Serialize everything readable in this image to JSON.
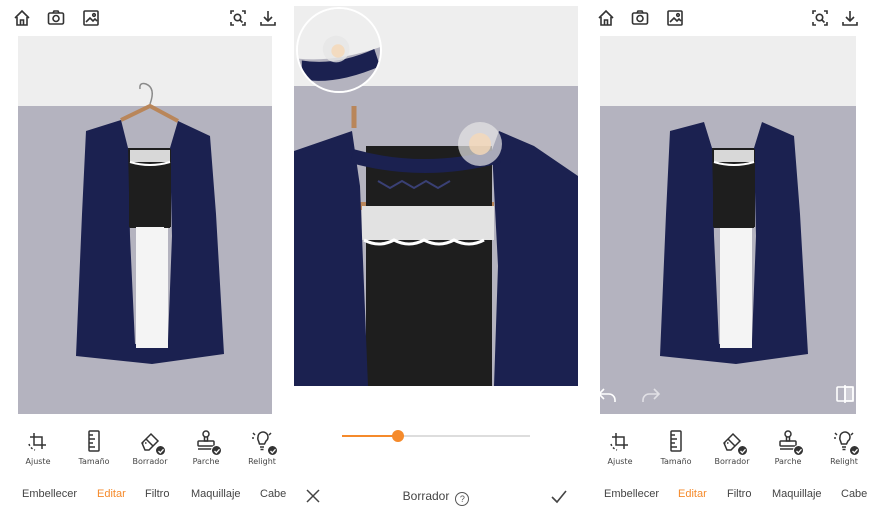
{
  "left_panel": {
    "tools": [
      {
        "label": "Ajuste",
        "icon": "crop-rotate-icon",
        "badge": false
      },
      {
        "label": "Tamaño",
        "icon": "ruler-icon",
        "badge": false
      },
      {
        "label": "Borrador",
        "icon": "eraser-icon",
        "badge": true
      },
      {
        "label": "Parche",
        "icon": "stamp-icon",
        "badge": true
      },
      {
        "label": "Relight",
        "icon": "lightbulb-icon",
        "badge": true
      }
    ],
    "nav": [
      "Embellecer",
      "Editar",
      "Filtro",
      "Maquillaje",
      "Cabe"
    ],
    "active_nav": "Editar"
  },
  "middle_panel": {
    "title": "Borrador",
    "help": "?",
    "slider_value": 0.3
  },
  "right_panel": {
    "tools": [
      {
        "label": "Ajuste",
        "icon": "crop-rotate-icon",
        "badge": false
      },
      {
        "label": "Tamaño",
        "icon": "ruler-icon",
        "badge": false
      },
      {
        "label": "Borrador",
        "icon": "eraser-icon",
        "badge": true
      },
      {
        "label": "Parche",
        "icon": "stamp-icon",
        "badge": true
      },
      {
        "label": "Relight",
        "icon": "lightbulb-icon",
        "badge": true
      }
    ],
    "nav": [
      "Embellecer",
      "Editar",
      "Filtro",
      "Maquillaje",
      "Cabe"
    ],
    "active_nav": "Editar"
  },
  "colors": {
    "accent": "#f58a2b",
    "wall": "#b4b3bf",
    "wall_top": "#eeeeee",
    "vest": "#1b2150",
    "shirt_dark": "#1e1e1e",
    "shirt_white": "#f4f4f4"
  }
}
